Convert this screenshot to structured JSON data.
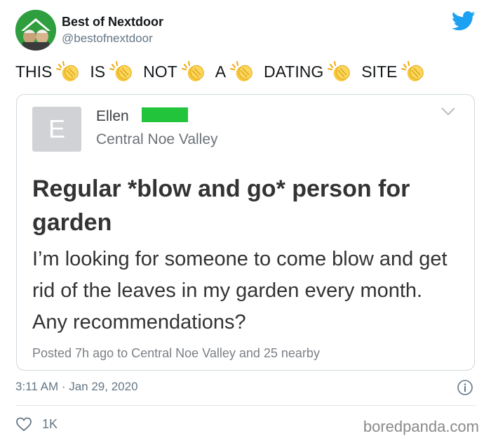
{
  "header": {
    "display_name": "Best of Nextdoor",
    "handle": "@bestofnextdoor",
    "avatar_icon": "muppet-avatar-icon",
    "bird_icon": "twitter-bird-icon",
    "brand_color": "#1da1f2"
  },
  "tweet": {
    "words": [
      "THIS",
      "IS",
      "NOT",
      "A",
      "DATING",
      "SITE"
    ],
    "emoji_icon": "clapping-hands-icon"
  },
  "card": {
    "initial": "E",
    "poster_name": "Ellen",
    "redaction_color": "#22c43b",
    "location": "Central Noe Valley",
    "title": "Regular *blow and go* person for garden",
    "body": "I’m looking for someone to come blow and get rid of the leaves in my garden every month. Any recommendations?",
    "posted": "Posted 7h ago to Central Noe Valley and 25 nearby"
  },
  "footer": {
    "timestamp": "3:11 AM · Jan 29, 2020",
    "likes": "1K",
    "watermark": "boredpanda.com"
  }
}
